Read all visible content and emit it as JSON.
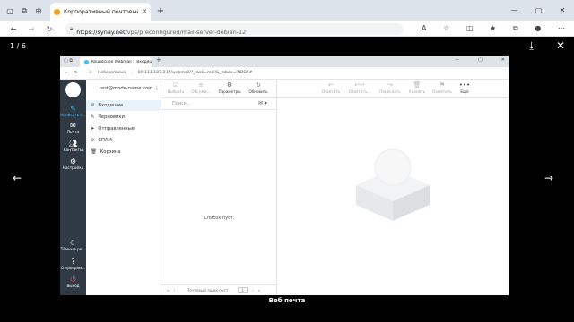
{
  "outer_browser": {
    "tab_title": "Корпоративный почтовый серв",
    "url_domain": "https://synay.net",
    "url_path": "/vps/preconfigured/mail-server-debian-12"
  },
  "lightbox": {
    "counter": "1 / 6",
    "caption": "Веб почта"
  },
  "inner_browser": {
    "tab_title": "Roundcube Webmail :: Входящи",
    "insecure_label": "Небезопасно",
    "url": "89.111.187.235/webmail/?_task=mail&_mbox=INBOX#"
  },
  "roundcube": {
    "user": "test@mode-name.com",
    "nav": {
      "compose": "Написать с...",
      "mail": "Почта",
      "contacts": "Контакты",
      "settings": "Настройки",
      "theme": "Тёмный ре...",
      "about": "О програм...",
      "logout": "Выход"
    },
    "toolbar_left": {
      "select": "Выбрать",
      "threads": "Обсужд...",
      "options": "Параметры",
      "refresh": "Обновить"
    },
    "toolbar_right": {
      "reply": "Ответить",
      "reply_all": "Ответить...",
      "forward": "Переслать",
      "delete": "Удалить",
      "mark": "Пометить",
      "more": "Ещё"
    },
    "folders": [
      "Входящие",
      "Черновики",
      "Отправленные",
      "СПАМ",
      "Корзина"
    ],
    "search_placeholder": "Поиск...",
    "empty_list": "Список пуст.",
    "pager_label": "Почтовый ящик пуст",
    "pager_page": "1"
  },
  "colors": {
    "nav_bg": "#2f3a45",
    "compose_accent": "#37beff",
    "logout_accent": "#d9534f"
  }
}
